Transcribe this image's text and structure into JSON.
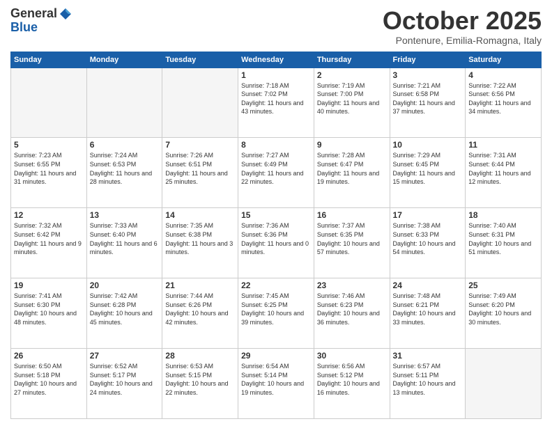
{
  "logo": {
    "general": "General",
    "blue": "Blue"
  },
  "header": {
    "month": "October 2025",
    "location": "Pontenure, Emilia-Romagna, Italy"
  },
  "weekdays": [
    "Sunday",
    "Monday",
    "Tuesday",
    "Wednesday",
    "Thursday",
    "Friday",
    "Saturday"
  ],
  "weeks": [
    [
      {
        "day": "",
        "sunrise": "",
        "sunset": "",
        "daylight": ""
      },
      {
        "day": "",
        "sunrise": "",
        "sunset": "",
        "daylight": ""
      },
      {
        "day": "",
        "sunrise": "",
        "sunset": "",
        "daylight": ""
      },
      {
        "day": "1",
        "sunrise": "7:18 AM",
        "sunset": "7:02 PM",
        "daylight": "11 hours and 43 minutes."
      },
      {
        "day": "2",
        "sunrise": "7:19 AM",
        "sunset": "7:00 PM",
        "daylight": "11 hours and 40 minutes."
      },
      {
        "day": "3",
        "sunrise": "7:21 AM",
        "sunset": "6:58 PM",
        "daylight": "11 hours and 37 minutes."
      },
      {
        "day": "4",
        "sunrise": "7:22 AM",
        "sunset": "6:56 PM",
        "daylight": "11 hours and 34 minutes."
      }
    ],
    [
      {
        "day": "5",
        "sunrise": "7:23 AM",
        "sunset": "6:55 PM",
        "daylight": "11 hours and 31 minutes."
      },
      {
        "day": "6",
        "sunrise": "7:24 AM",
        "sunset": "6:53 PM",
        "daylight": "11 hours and 28 minutes."
      },
      {
        "day": "7",
        "sunrise": "7:26 AM",
        "sunset": "6:51 PM",
        "daylight": "11 hours and 25 minutes."
      },
      {
        "day": "8",
        "sunrise": "7:27 AM",
        "sunset": "6:49 PM",
        "daylight": "11 hours and 22 minutes."
      },
      {
        "day": "9",
        "sunrise": "7:28 AM",
        "sunset": "6:47 PM",
        "daylight": "11 hours and 19 minutes."
      },
      {
        "day": "10",
        "sunrise": "7:29 AM",
        "sunset": "6:45 PM",
        "daylight": "11 hours and 15 minutes."
      },
      {
        "day": "11",
        "sunrise": "7:31 AM",
        "sunset": "6:44 PM",
        "daylight": "11 hours and 12 minutes."
      }
    ],
    [
      {
        "day": "12",
        "sunrise": "7:32 AM",
        "sunset": "6:42 PM",
        "daylight": "11 hours and 9 minutes."
      },
      {
        "day": "13",
        "sunrise": "7:33 AM",
        "sunset": "6:40 PM",
        "daylight": "11 hours and 6 minutes."
      },
      {
        "day": "14",
        "sunrise": "7:35 AM",
        "sunset": "6:38 PM",
        "daylight": "11 hours and 3 minutes."
      },
      {
        "day": "15",
        "sunrise": "7:36 AM",
        "sunset": "6:36 PM",
        "daylight": "11 hours and 0 minutes."
      },
      {
        "day": "16",
        "sunrise": "7:37 AM",
        "sunset": "6:35 PM",
        "daylight": "10 hours and 57 minutes."
      },
      {
        "day": "17",
        "sunrise": "7:38 AM",
        "sunset": "6:33 PM",
        "daylight": "10 hours and 54 minutes."
      },
      {
        "day": "18",
        "sunrise": "7:40 AM",
        "sunset": "6:31 PM",
        "daylight": "10 hours and 51 minutes."
      }
    ],
    [
      {
        "day": "19",
        "sunrise": "7:41 AM",
        "sunset": "6:30 PM",
        "daylight": "10 hours and 48 minutes."
      },
      {
        "day": "20",
        "sunrise": "7:42 AM",
        "sunset": "6:28 PM",
        "daylight": "10 hours and 45 minutes."
      },
      {
        "day": "21",
        "sunrise": "7:44 AM",
        "sunset": "6:26 PM",
        "daylight": "10 hours and 42 minutes."
      },
      {
        "day": "22",
        "sunrise": "7:45 AM",
        "sunset": "6:25 PM",
        "daylight": "10 hours and 39 minutes."
      },
      {
        "day": "23",
        "sunrise": "7:46 AM",
        "sunset": "6:23 PM",
        "daylight": "10 hours and 36 minutes."
      },
      {
        "day": "24",
        "sunrise": "7:48 AM",
        "sunset": "6:21 PM",
        "daylight": "10 hours and 33 minutes."
      },
      {
        "day": "25",
        "sunrise": "7:49 AM",
        "sunset": "6:20 PM",
        "daylight": "10 hours and 30 minutes."
      }
    ],
    [
      {
        "day": "26",
        "sunrise": "6:50 AM",
        "sunset": "5:18 PM",
        "daylight": "10 hours and 27 minutes."
      },
      {
        "day": "27",
        "sunrise": "6:52 AM",
        "sunset": "5:17 PM",
        "daylight": "10 hours and 24 minutes."
      },
      {
        "day": "28",
        "sunrise": "6:53 AM",
        "sunset": "5:15 PM",
        "daylight": "10 hours and 22 minutes."
      },
      {
        "day": "29",
        "sunrise": "6:54 AM",
        "sunset": "5:14 PM",
        "daylight": "10 hours and 19 minutes."
      },
      {
        "day": "30",
        "sunrise": "6:56 AM",
        "sunset": "5:12 PM",
        "daylight": "10 hours and 16 minutes."
      },
      {
        "day": "31",
        "sunrise": "6:57 AM",
        "sunset": "5:11 PM",
        "daylight": "10 hours and 13 minutes."
      },
      {
        "day": "",
        "sunrise": "",
        "sunset": "",
        "daylight": ""
      }
    ]
  ]
}
